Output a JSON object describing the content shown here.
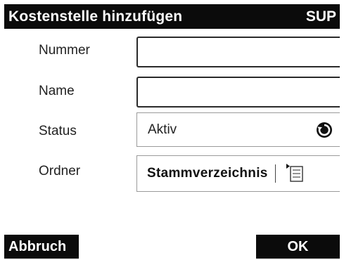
{
  "header": {
    "title": "Kostenstelle hinzufügen",
    "user": "SUP"
  },
  "form": {
    "nummer": {
      "label": "Nummer",
      "value": ""
    },
    "name": {
      "label": "Name",
      "value": ""
    },
    "status": {
      "label": "Status",
      "value": "Aktiv",
      "icon": "cycle-icon"
    },
    "ordner": {
      "label": "Ordner",
      "value": "Stammverzeichnis",
      "icon": "folder-tree-icon"
    }
  },
  "buttons": {
    "cancel_label": "Abbruch",
    "ok_label": "OK"
  },
  "colors": {
    "bar_background": "#0b0b0b",
    "bar_text": "#ffffff",
    "background": "#ffffff"
  }
}
